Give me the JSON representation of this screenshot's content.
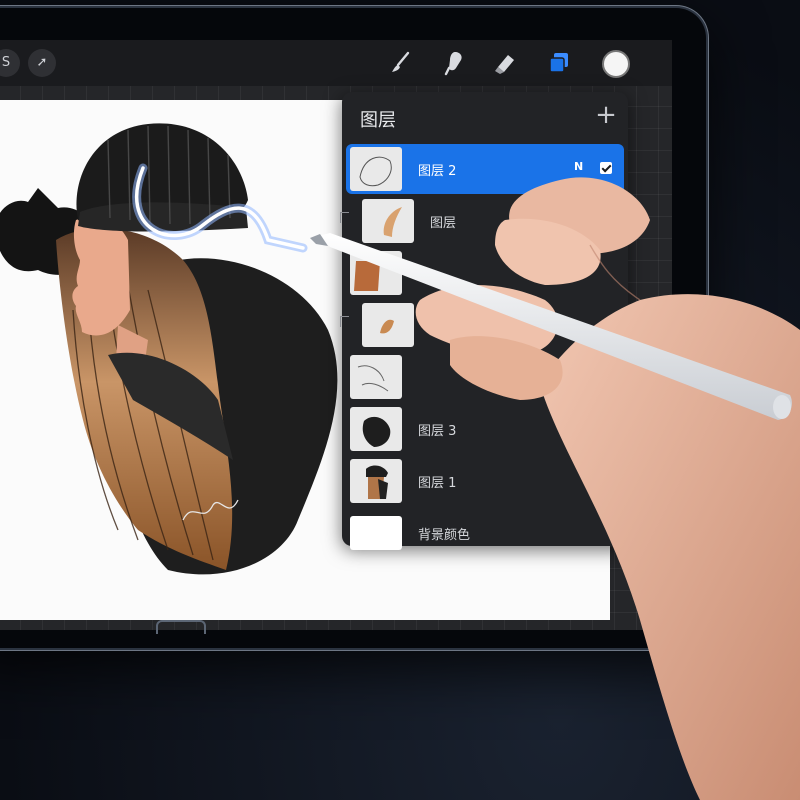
{
  "toolbar": {
    "left_buttons": [
      {
        "name": "s-adjust",
        "glyph": "S"
      },
      {
        "name": "select-arrow",
        "glyph": "➚"
      }
    ],
    "tools": [
      "brush-icon",
      "smudge-icon",
      "eraser-icon",
      "layers-icon"
    ],
    "active_color": "#f5f5f5",
    "accent_color": "#1a73e8"
  },
  "layers_panel": {
    "title": "图层",
    "add_label": "+",
    "layers": [
      {
        "name": "图层 2",
        "mode": "N",
        "visible": true,
        "active": true
      },
      {
        "name": "图层",
        "mode": "",
        "visible": true,
        "active": false,
        "clipped": true
      },
      {
        "name": "",
        "mode": "",
        "visible": true,
        "active": false
      },
      {
        "name": "",
        "mode": "",
        "visible": true,
        "active": false,
        "clipped": true
      },
      {
        "name": "",
        "mode": "",
        "visible": true,
        "active": false
      },
      {
        "name": "图层 3",
        "mode": "",
        "visible": true,
        "active": false
      },
      {
        "name": "图层 1",
        "mode": "",
        "visible": true,
        "active": false
      },
      {
        "name": "背景颜色",
        "mode": "",
        "visible": true,
        "active": false,
        "background": true
      }
    ]
  }
}
